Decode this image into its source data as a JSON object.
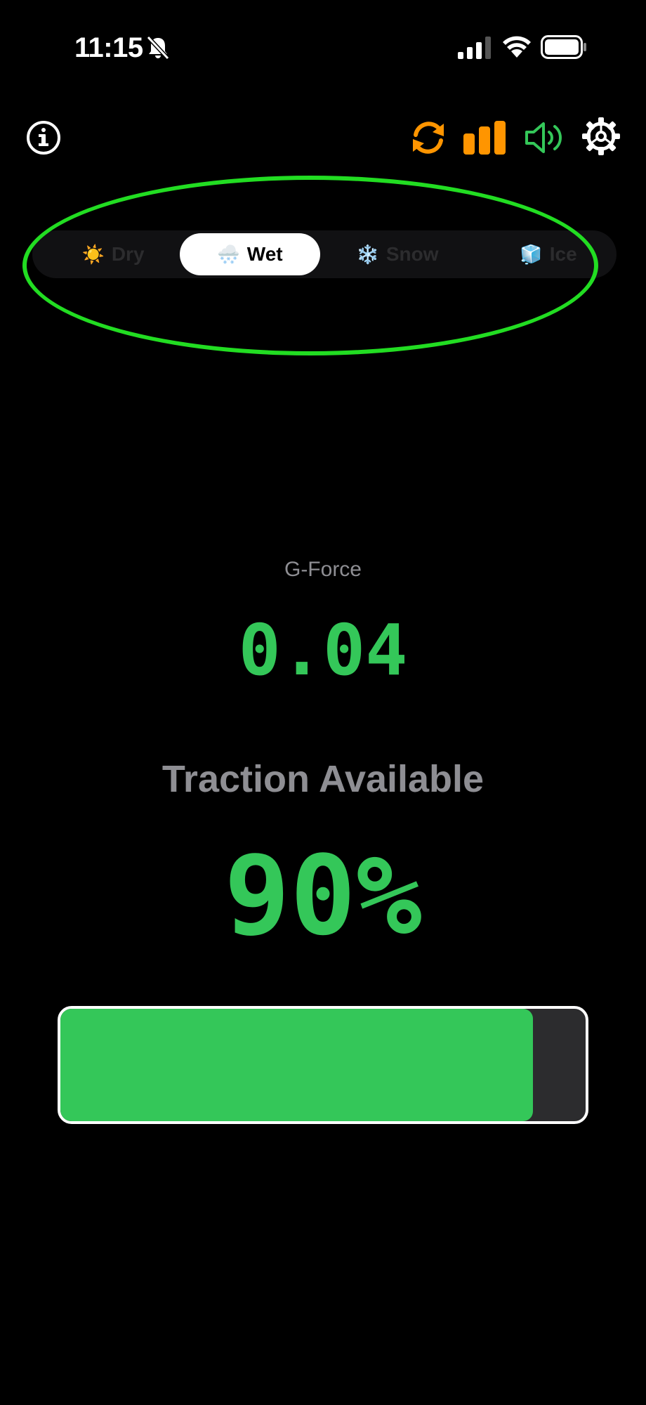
{
  "status_bar": {
    "time": "11:15",
    "icons": [
      "bell-slash-icon",
      "cellular-signal-icon",
      "wifi-icon",
      "battery-icon"
    ]
  },
  "toolbar": {
    "icons": [
      "info-icon",
      "sync-icon",
      "signal-bars-icon",
      "speaker-icon",
      "gear-icon"
    ],
    "colors": {
      "sync": "#ff9500",
      "bars": "#ff9500",
      "speaker": "#34c759",
      "info": "#ffffff",
      "gear": "#ffffff"
    }
  },
  "surface": {
    "options": [
      {
        "emoji": "☀️",
        "label": "Dry"
      },
      {
        "emoji": "🌨️",
        "label": "Wet"
      },
      {
        "emoji": "❄️",
        "label": "Snow"
      },
      {
        "emoji": "🧊",
        "label": "Ice"
      }
    ],
    "selected": "Wet"
  },
  "readouts": {
    "gforce_label": "G-Force",
    "gforce_value": "0.04",
    "traction_label": "Traction Available",
    "traction_value": "90%",
    "traction_fraction": 0.9
  },
  "colors": {
    "accent_green": "#34c759",
    "accent_orange": "#ff9500",
    "label_gray": "#8e8e93",
    "track": "#2c2c2e",
    "highlight_ring": "#22dd22"
  }
}
